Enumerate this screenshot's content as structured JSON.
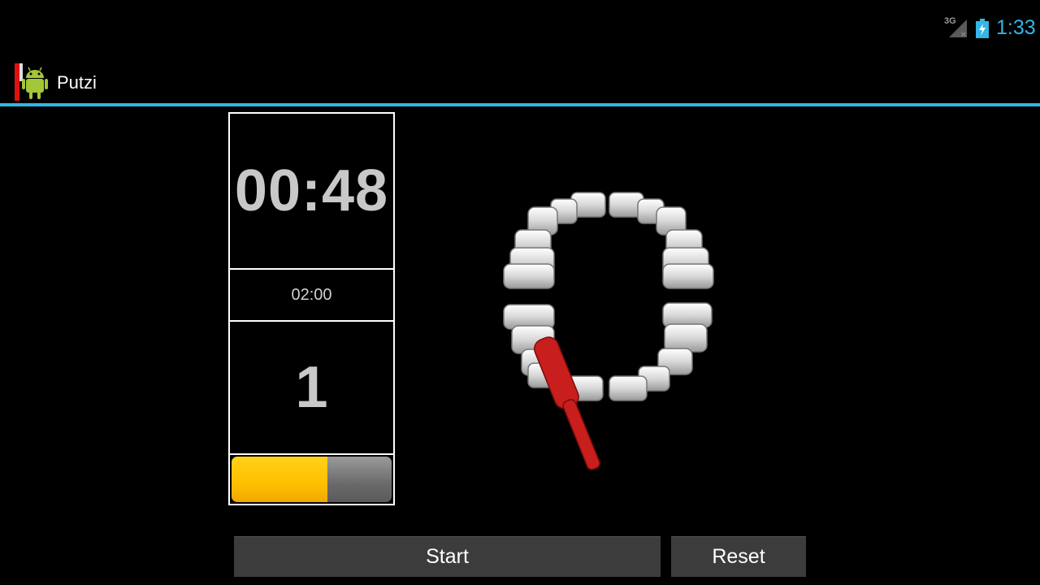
{
  "status_bar": {
    "network": "3G",
    "time": "1:33",
    "accent_color": "#33b5e5"
  },
  "action_bar": {
    "title": "Putzi",
    "icon": "android-robot-icon"
  },
  "timer": {
    "elapsed": "00:48",
    "total": "02:00",
    "section": "1",
    "progress_fraction": 0.6,
    "progress_color": "#ffbf00"
  },
  "illustration": {
    "icon": "teeth-with-toothbrush-icon",
    "brush_color": "#d42020"
  },
  "buttons": {
    "start": "Start",
    "reset": "Reset"
  }
}
